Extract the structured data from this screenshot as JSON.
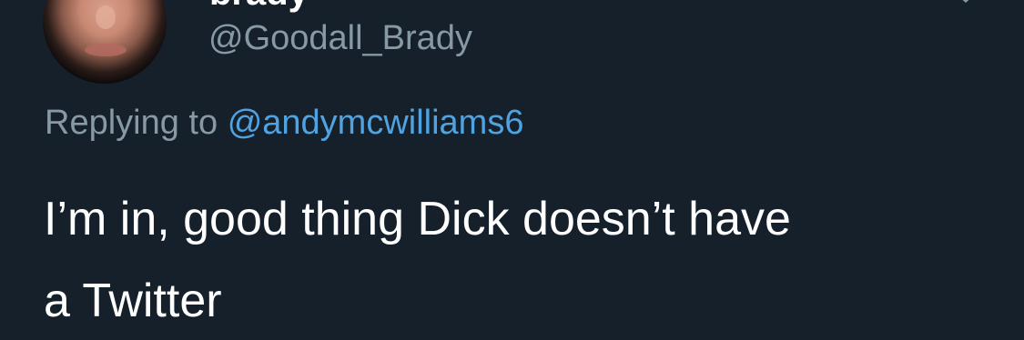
{
  "tweet": {
    "display_name": "brady",
    "handle": "@Goodall_Brady",
    "replying_prefix": "Replying to",
    "replying_to": "@andymcwilliams6",
    "text_line1": "I’m in, good thing Dick doesn’t have",
    "text_line2": "a Twitter"
  },
  "icons": {
    "avatar": "profile-photo",
    "more": "chevron-down-icon"
  },
  "colors": {
    "background": "#15202b",
    "primary_text": "#ffffff",
    "secondary_text": "#8899a6",
    "link": "#4fa3e0"
  }
}
